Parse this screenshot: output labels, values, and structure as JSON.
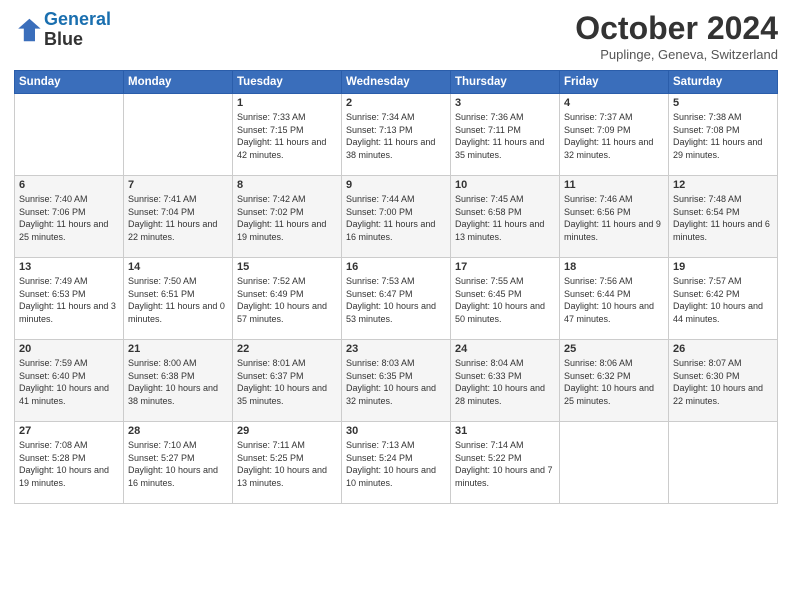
{
  "logo": {
    "line1": "General",
    "line2": "Blue"
  },
  "title": "October 2024",
  "location": "Puplinge, Geneva, Switzerland",
  "days_header": [
    "Sunday",
    "Monday",
    "Tuesday",
    "Wednesday",
    "Thursday",
    "Friday",
    "Saturday"
  ],
  "weeks": [
    [
      {
        "day": "",
        "sunrise": "",
        "sunset": "",
        "daylight": ""
      },
      {
        "day": "",
        "sunrise": "",
        "sunset": "",
        "daylight": ""
      },
      {
        "day": "1",
        "sunrise": "Sunrise: 7:33 AM",
        "sunset": "Sunset: 7:15 PM",
        "daylight": "Daylight: 11 hours and 42 minutes."
      },
      {
        "day": "2",
        "sunrise": "Sunrise: 7:34 AM",
        "sunset": "Sunset: 7:13 PM",
        "daylight": "Daylight: 11 hours and 38 minutes."
      },
      {
        "day": "3",
        "sunrise": "Sunrise: 7:36 AM",
        "sunset": "Sunset: 7:11 PM",
        "daylight": "Daylight: 11 hours and 35 minutes."
      },
      {
        "day": "4",
        "sunrise": "Sunrise: 7:37 AM",
        "sunset": "Sunset: 7:09 PM",
        "daylight": "Daylight: 11 hours and 32 minutes."
      },
      {
        "day": "5",
        "sunrise": "Sunrise: 7:38 AM",
        "sunset": "Sunset: 7:08 PM",
        "daylight": "Daylight: 11 hours and 29 minutes."
      }
    ],
    [
      {
        "day": "6",
        "sunrise": "Sunrise: 7:40 AM",
        "sunset": "Sunset: 7:06 PM",
        "daylight": "Daylight: 11 hours and 25 minutes."
      },
      {
        "day": "7",
        "sunrise": "Sunrise: 7:41 AM",
        "sunset": "Sunset: 7:04 PM",
        "daylight": "Daylight: 11 hours and 22 minutes."
      },
      {
        "day": "8",
        "sunrise": "Sunrise: 7:42 AM",
        "sunset": "Sunset: 7:02 PM",
        "daylight": "Daylight: 11 hours and 19 minutes."
      },
      {
        "day": "9",
        "sunrise": "Sunrise: 7:44 AM",
        "sunset": "Sunset: 7:00 PM",
        "daylight": "Daylight: 11 hours and 16 minutes."
      },
      {
        "day": "10",
        "sunrise": "Sunrise: 7:45 AM",
        "sunset": "Sunset: 6:58 PM",
        "daylight": "Daylight: 11 hours and 13 minutes."
      },
      {
        "day": "11",
        "sunrise": "Sunrise: 7:46 AM",
        "sunset": "Sunset: 6:56 PM",
        "daylight": "Daylight: 11 hours and 9 minutes."
      },
      {
        "day": "12",
        "sunrise": "Sunrise: 7:48 AM",
        "sunset": "Sunset: 6:54 PM",
        "daylight": "Daylight: 11 hours and 6 minutes."
      }
    ],
    [
      {
        "day": "13",
        "sunrise": "Sunrise: 7:49 AM",
        "sunset": "Sunset: 6:53 PM",
        "daylight": "Daylight: 11 hours and 3 minutes."
      },
      {
        "day": "14",
        "sunrise": "Sunrise: 7:50 AM",
        "sunset": "Sunset: 6:51 PM",
        "daylight": "Daylight: 11 hours and 0 minutes."
      },
      {
        "day": "15",
        "sunrise": "Sunrise: 7:52 AM",
        "sunset": "Sunset: 6:49 PM",
        "daylight": "Daylight: 10 hours and 57 minutes."
      },
      {
        "day": "16",
        "sunrise": "Sunrise: 7:53 AM",
        "sunset": "Sunset: 6:47 PM",
        "daylight": "Daylight: 10 hours and 53 minutes."
      },
      {
        "day": "17",
        "sunrise": "Sunrise: 7:55 AM",
        "sunset": "Sunset: 6:45 PM",
        "daylight": "Daylight: 10 hours and 50 minutes."
      },
      {
        "day": "18",
        "sunrise": "Sunrise: 7:56 AM",
        "sunset": "Sunset: 6:44 PM",
        "daylight": "Daylight: 10 hours and 47 minutes."
      },
      {
        "day": "19",
        "sunrise": "Sunrise: 7:57 AM",
        "sunset": "Sunset: 6:42 PM",
        "daylight": "Daylight: 10 hours and 44 minutes."
      }
    ],
    [
      {
        "day": "20",
        "sunrise": "Sunrise: 7:59 AM",
        "sunset": "Sunset: 6:40 PM",
        "daylight": "Daylight: 10 hours and 41 minutes."
      },
      {
        "day": "21",
        "sunrise": "Sunrise: 8:00 AM",
        "sunset": "Sunset: 6:38 PM",
        "daylight": "Daylight: 10 hours and 38 minutes."
      },
      {
        "day": "22",
        "sunrise": "Sunrise: 8:01 AM",
        "sunset": "Sunset: 6:37 PM",
        "daylight": "Daylight: 10 hours and 35 minutes."
      },
      {
        "day": "23",
        "sunrise": "Sunrise: 8:03 AM",
        "sunset": "Sunset: 6:35 PM",
        "daylight": "Daylight: 10 hours and 32 minutes."
      },
      {
        "day": "24",
        "sunrise": "Sunrise: 8:04 AM",
        "sunset": "Sunset: 6:33 PM",
        "daylight": "Daylight: 10 hours and 28 minutes."
      },
      {
        "day": "25",
        "sunrise": "Sunrise: 8:06 AM",
        "sunset": "Sunset: 6:32 PM",
        "daylight": "Daylight: 10 hours and 25 minutes."
      },
      {
        "day": "26",
        "sunrise": "Sunrise: 8:07 AM",
        "sunset": "Sunset: 6:30 PM",
        "daylight": "Daylight: 10 hours and 22 minutes."
      }
    ],
    [
      {
        "day": "27",
        "sunrise": "Sunrise: 7:08 AM",
        "sunset": "Sunset: 5:28 PM",
        "daylight": "Daylight: 10 hours and 19 minutes."
      },
      {
        "day": "28",
        "sunrise": "Sunrise: 7:10 AM",
        "sunset": "Sunset: 5:27 PM",
        "daylight": "Daylight: 10 hours and 16 minutes."
      },
      {
        "day": "29",
        "sunrise": "Sunrise: 7:11 AM",
        "sunset": "Sunset: 5:25 PM",
        "daylight": "Daylight: 10 hours and 13 minutes."
      },
      {
        "day": "30",
        "sunrise": "Sunrise: 7:13 AM",
        "sunset": "Sunset: 5:24 PM",
        "daylight": "Daylight: 10 hours and 10 minutes."
      },
      {
        "day": "31",
        "sunrise": "Sunrise: 7:14 AM",
        "sunset": "Sunset: 5:22 PM",
        "daylight": "Daylight: 10 hours and 7 minutes."
      },
      {
        "day": "",
        "sunrise": "",
        "sunset": "",
        "daylight": ""
      },
      {
        "day": "",
        "sunrise": "",
        "sunset": "",
        "daylight": ""
      }
    ]
  ]
}
